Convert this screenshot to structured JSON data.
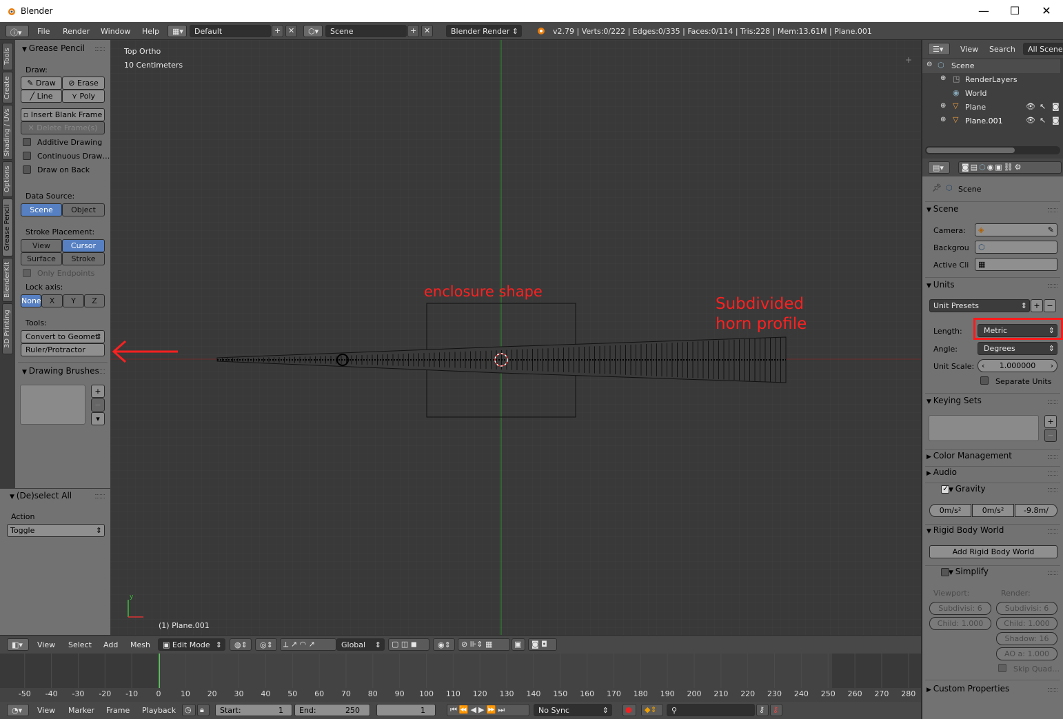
{
  "window": {
    "title": "Blender"
  },
  "infobar": {
    "menus": [
      "File",
      "Render",
      "Window",
      "Help"
    ],
    "screen_layout": "Default",
    "scene": "Scene",
    "render_engine": "Blender Render",
    "stats": "v2.79 | Verts:0/222 | Edges:0/335 | Faces:0/114 | Tris:228 | Mem:13.61M | Plane.001"
  },
  "vtabs": [
    "Tools",
    "Create",
    "Shading / UVs",
    "Options",
    "Grease Pencil",
    "BlenderKit",
    "3D Printing"
  ],
  "grease_pencil": {
    "title": "Grease Pencil",
    "draw_label": "Draw:",
    "draw": "Draw",
    "erase": "Erase",
    "line": "Line",
    "poly": "Poly",
    "insert_blank": "Insert Blank Frame",
    "delete_frames": "Delete Frame(s)",
    "additive": "Additive Drawing",
    "continuous": "Continuous Draw…",
    "draw_on_back": "Draw on Back",
    "data_source_label": "Data Source:",
    "ds_scene": "Scene",
    "ds_object": "Object",
    "stroke_placement_label": "Stroke Placement:",
    "sp_view": "View",
    "sp_cursor": "Cursor",
    "sp_surface": "Surface",
    "sp_stroke": "Stroke",
    "only_endpoints": "Only Endpoints",
    "lock_axis_label": "Lock axis:",
    "lock_none": "None",
    "lock_x": "X",
    "lock_y": "Y",
    "lock_z": "Z",
    "tools_label": "Tools:",
    "convert": "Convert to Geomet",
    "ruler": "Ruler/Protractor",
    "brushes_title": "Drawing Brushes"
  },
  "operator": {
    "title": "(De)select All",
    "action_label": "Action",
    "action_value": "Toggle"
  },
  "viewport": {
    "view_name": "Top Ortho",
    "scale": "10 Centimeters",
    "object_info": "(1) Plane.001",
    "annotation_enclosure": "enclosure shape",
    "annotation_horn_1": "Subdivided",
    "annotation_horn_2": "horn profile",
    "axis_y": "y",
    "annotation_color": "#ff2020"
  },
  "vpheader": {
    "menus": [
      "View",
      "Select",
      "Add",
      "Mesh"
    ],
    "mode": "Edit Mode",
    "orientation": "Global"
  },
  "timeline": {
    "ticks": [
      -50,
      -40,
      -30,
      -20,
      -10,
      0,
      10,
      20,
      30,
      40,
      50,
      60,
      70,
      80,
      90,
      100,
      110,
      120,
      130,
      140,
      150,
      160,
      170,
      180,
      190,
      200,
      210,
      220,
      230,
      240,
      250,
      260,
      270,
      280
    ]
  },
  "tlheader": {
    "menus": [
      "View",
      "Marker",
      "Frame",
      "Playback"
    ],
    "start_label": "Start:",
    "start": "1",
    "end_label": "End:",
    "end": "250",
    "current": "1",
    "sync": "No Sync"
  },
  "outliner": {
    "menus": [
      "View",
      "Search"
    ],
    "filter": "All Scenes",
    "items": [
      "Scene",
      "RenderLayers",
      "World",
      "Plane",
      "Plane.001"
    ]
  },
  "props": {
    "context": "Scene",
    "scene_section": "Scene",
    "camera_label": "Camera:",
    "background_label": "Backgrou",
    "active_clip_label": "Active Cli",
    "units_section": "Units",
    "unit_presets": "Unit Presets",
    "length_label": "Length:",
    "length_value": "Metric",
    "angle_label": "Angle:",
    "angle_value": "Degrees",
    "unit_scale_label": "Unit Scale:",
    "unit_scale_value": "1.000000",
    "separate_units": "Separate Units",
    "keying_sets": "Keying Sets",
    "color_management": "Color Management",
    "audio": "Audio",
    "gravity": "Gravity",
    "grav_x": "0m/s²",
    "grav_y": "0m/s²",
    "grav_z": "-9.8m/",
    "rigid_body_world": "Rigid Body World",
    "add_rigid": "Add Rigid Body World",
    "simplify": "Simplify",
    "viewport_label": "Viewport:",
    "render_label": "Render:",
    "vp_subdiv": "Subdivisi: 6",
    "vp_child": "Child: 1.000",
    "r_subdiv": "Subdivisi: 6",
    "r_child": "Child: 1.000",
    "r_shadow": "Shadow: 16",
    "r_ao": "AO a: 1.000",
    "skip_quad": "Skip Quad…",
    "custom_props": "Custom Properties"
  }
}
